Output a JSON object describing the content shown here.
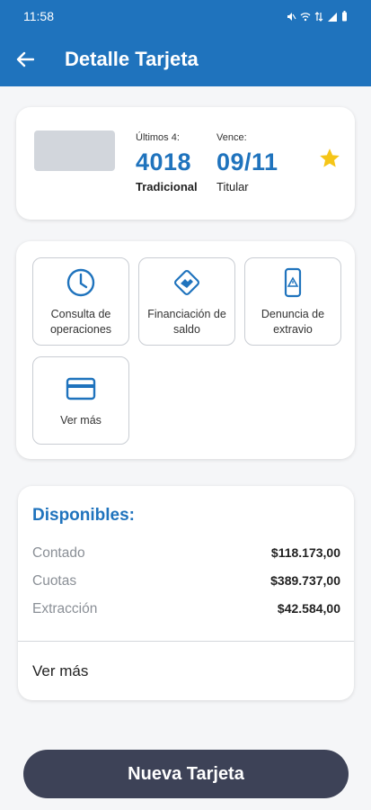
{
  "status_bar": {
    "time": "11:58"
  },
  "header": {
    "title": "Detalle Tarjeta",
    "back_icon": "arrow-left-icon"
  },
  "card_summary": {
    "last4_label": "Últimos 4:",
    "last4_value": "4018",
    "type": "Tradicional",
    "expiry_label": "Vence:",
    "expiry_value": "09/11",
    "holder": "Titular",
    "favorite_icon": "star-icon"
  },
  "actions": [
    {
      "label": "Consulta de operaciones",
      "icon": "clock-icon"
    },
    {
      "label": "Financiación de saldo",
      "icon": "handshake-icon"
    },
    {
      "label": "Denuncia de extravio",
      "icon": "phone-alert-icon"
    },
    {
      "label": "Ver más",
      "icon": "credit-card-icon"
    }
  ],
  "available": {
    "title": "Disponibles:",
    "rows": [
      {
        "label": "Contado",
        "value": "$118.173,00"
      },
      {
        "label": "Cuotas",
        "value": "$389.737,00"
      },
      {
        "label": "Extracción",
        "value": "$42.584,00"
      }
    ],
    "more_label": "Ver más"
  },
  "primary_button": {
    "label": "Nueva Tarjeta"
  },
  "colors": {
    "primary": "#1f73bd",
    "button": "#3d4257",
    "star": "#f5c518"
  }
}
